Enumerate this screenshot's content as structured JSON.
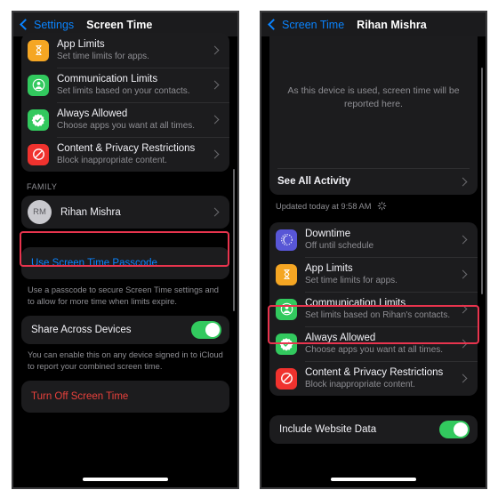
{
  "left_phone": {
    "nav": {
      "back_label": "Settings",
      "title": "Screen Time",
      "back_icon": "chevron-left-icon"
    },
    "settings_rows": [
      {
        "icon": "hourglass-icon",
        "title": "App Limits",
        "subtitle": "Set time limits for apps."
      },
      {
        "icon": "person-circle-icon",
        "title": "Communication Limits",
        "subtitle": "Set limits based on your contacts."
      },
      {
        "icon": "checkmark-seal-icon",
        "title": "Always Allowed",
        "subtitle": "Choose apps you want at all times."
      },
      {
        "icon": "no-entry-icon",
        "title": "Content & Privacy Restrictions",
        "subtitle": "Block inappropriate content."
      }
    ],
    "family_header": "FAMILY",
    "family_member": {
      "initials": "RM",
      "name": "Rihan Mishra"
    },
    "passcode_label": "Use Screen Time Passcode",
    "passcode_footnote": "Use a passcode to secure Screen Time settings and to allow for more time when limits expire.",
    "share_label": "Share Across Devices",
    "share_enabled": true,
    "share_footnote": "You can enable this on any device signed in to iCloud to report your combined screen time.",
    "turn_off_label": "Turn Off Screen Time"
  },
  "right_phone": {
    "nav": {
      "back_label": "Screen Time",
      "title": "Rihan Mishra",
      "back_icon": "chevron-left-icon"
    },
    "activity": {
      "message": "As this device is used, screen time will be reported here.",
      "see_all_label": "See All Activity",
      "updated_text": "Updated today at 9:58 AM",
      "spinner_icon": "activity-spinner-icon"
    },
    "settings_rows": [
      {
        "icon": "moon-downtime-icon",
        "title": "Downtime",
        "subtitle": "Off until schedule"
      },
      {
        "icon": "hourglass-icon",
        "title": "App Limits",
        "subtitle": "Set time limits for apps."
      },
      {
        "icon": "person-circle-icon",
        "title": "Communication Limits",
        "subtitle": "Set limits based on Rihan's contacts."
      },
      {
        "icon": "checkmark-seal-icon",
        "title": "Always Allowed",
        "subtitle": "Choose apps you want at all times."
      },
      {
        "icon": "no-entry-icon",
        "title": "Content & Privacy Restrictions",
        "subtitle": "Block inappropriate content."
      }
    ],
    "include_website_label": "Include Website Data",
    "include_website_enabled": true
  },
  "colors": {
    "accent_blue": "#0a84ff",
    "destructive_red": "#e8413c",
    "toggle_green": "#32c95e",
    "highlight_red": "#e8344e",
    "card_bg": "#1c1c1e",
    "screen_bg": "#000000"
  }
}
